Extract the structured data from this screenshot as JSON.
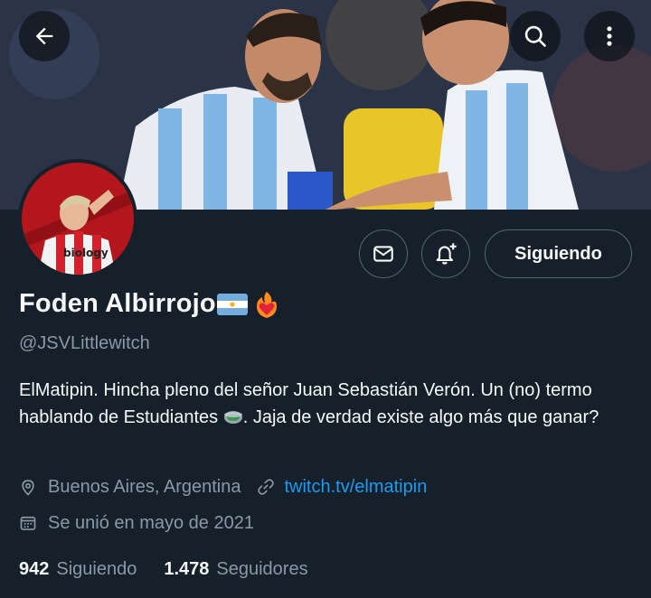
{
  "header": {
    "back_icon": "arrow-left-icon",
    "search_icon": "search-icon",
    "more_icon": "more-vertical-icon"
  },
  "banner": {
    "description_icon": "banner-photo"
  },
  "actions": {
    "message_icon": "mail-icon",
    "notify_icon": "bell-plus-icon",
    "follow_label": "Siguiendo"
  },
  "profile": {
    "name": "Foden Albirrojo",
    "name_emojis": [
      "flag-argentina-icon",
      "heart-on-fire-icon"
    ],
    "handle": "@JSVLittlewitch",
    "bio_part1": "ElMatipin. Hincha pleno del señor Juan Sebastián Verón. Un (no) termo hablando de Estudiantes ",
    "bio_part2": ". Jaja de verdad existe algo más que ganar?",
    "location": "Buenos Aires, Argentina",
    "website": "twitch.tv/elmatipin",
    "joined": "Se unió en mayo de 2021"
  },
  "stats": {
    "following_count": "942",
    "following_label": "Siguiendo",
    "followers_count": "1.478",
    "followers_label": "Seguidores"
  },
  "colors": {
    "background": "#15202b",
    "text": "#f7f9f9",
    "secondary": "#8b98a5",
    "link": "#1d9bf0",
    "border": "#536471"
  }
}
